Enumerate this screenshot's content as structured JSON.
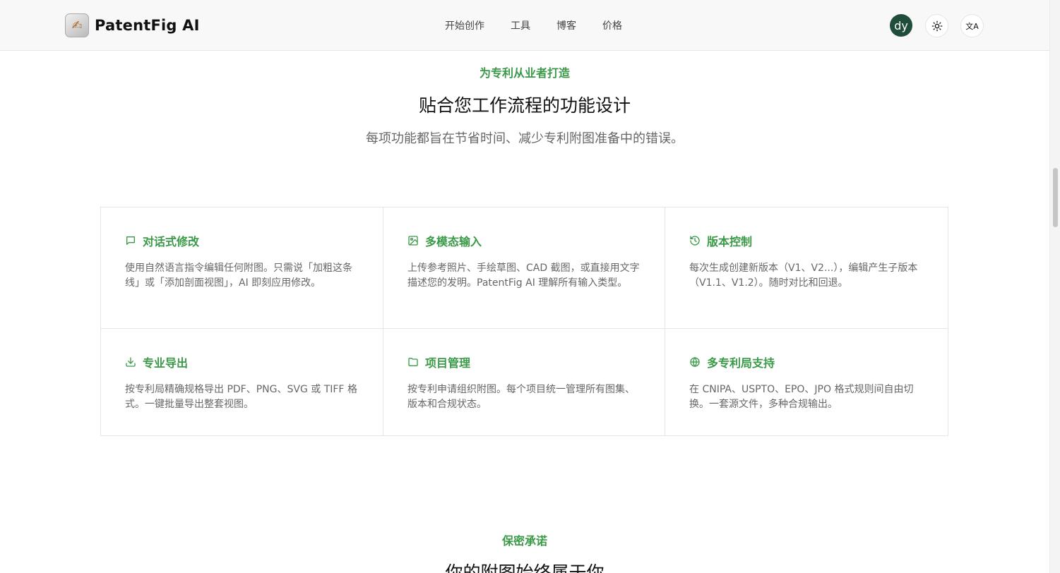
{
  "app": {
    "logo_glyph": "✍",
    "name": "PatentFig AI"
  },
  "nav": {
    "items": [
      "开始创作",
      "工具",
      "博客",
      "价格"
    ]
  },
  "header": {
    "avatar_initials": "dy",
    "language_glyph": "文A"
  },
  "features_section": {
    "eyebrow": "为专利从业者打造",
    "title": "贴合您工作流程的功能设计",
    "subtitle": "每项功能都旨在节省时间、减少专利附图准备中的错误。",
    "features": [
      {
        "icon": "chat-bubble-icon",
        "title": "对话式修改",
        "desc": "使用自然语言指令编辑任何附图。只需说「加粗这条线」或「添加剖面视图」，AI 即刻应用修改。"
      },
      {
        "icon": "image-icon",
        "title": "多模态输入",
        "desc": "上传参考照片、手绘草图、CAD 截图，或直接用文字描述您的发明。PatentFig AI 理解所有输入类型。"
      },
      {
        "icon": "history-icon",
        "title": "版本控制",
        "desc": "每次生成创建新版本（V1、V2...），编辑产生子版本（V1.1、V1.2）。随时对比和回退。"
      },
      {
        "icon": "download-icon",
        "title": "专业导出",
        "desc": "按专利局精确规格导出 PDF、PNG、SVG 或 TIFF 格式。一键批量导出整套视图。"
      },
      {
        "icon": "folder-icon",
        "title": "项目管理",
        "desc": "按专利申请组织附图。每个项目统一管理所有图集、版本和合规状态。"
      },
      {
        "icon": "globe-icon",
        "title": "多专利局支持",
        "desc": "在 CNIPA、USPTO、EPO、JPO 格式规则间自由切换。一套源文件，多种合规输出。"
      }
    ]
  },
  "privacy_section": {
    "eyebrow": "保密承诺",
    "title": "你的附图始终属于你"
  },
  "colors": {
    "accent": "#3a9a48",
    "avatar_bg": "#1f4d3a"
  }
}
